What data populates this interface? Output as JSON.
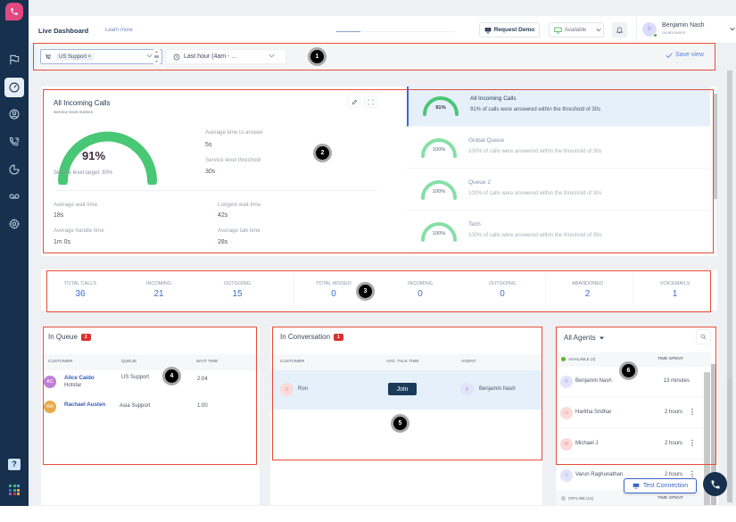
{
  "header": {
    "title": "Live Dashboard",
    "learn_more": "Learn more",
    "request_demo": "Request Demo",
    "status": "Available",
    "user_initial": "B",
    "user_name": "Benjamin Nash",
    "user_sub": "ON BROWSER",
    "loading_progress": 0.2
  },
  "filters": {
    "queue_chip": "US Support ×",
    "time_range": "Last hour (4am - ...",
    "save_view": "Save view"
  },
  "service_level": {
    "title": "All Incoming Calls",
    "subtitle": "Service level metrics",
    "percent": "91%",
    "gauge_value": 0.91,
    "target": "Service level target: 80%",
    "metrics": [
      {
        "label": "Average time to answer",
        "value": "5s"
      },
      {
        "label": "Service level threshold",
        "value": "30s"
      },
      {
        "label": "Average wait time",
        "value": "18s"
      },
      {
        "label": "Longest wait time",
        "value": "42s"
      },
      {
        "label": "Average handle time",
        "value": "1m 0s"
      },
      {
        "label": "Average talk time",
        "value": "28s"
      }
    ],
    "queues": [
      {
        "name": "All Incoming Calls",
        "percent": "91%",
        "value": 0.91,
        "desc": "91% of calls were answered within the threshold of 30s",
        "active": true
      },
      {
        "name": "Global Queue",
        "percent": "100%",
        "value": 1.0,
        "desc": "100% of calls were answered within the threshold of 30s",
        "active": false
      },
      {
        "name": "Queue 2",
        "percent": "100%",
        "value": 1.0,
        "desc": "100% of calls were answered within the threshold of 30s",
        "active": false
      },
      {
        "name": "Tech",
        "percent": "100%",
        "value": 1.0,
        "desc": "100% of calls were answered within the threshold of 30s",
        "active": false
      }
    ]
  },
  "stats": [
    {
      "label": "TOTAL CALLS",
      "value": "36"
    },
    {
      "label": "INCOMING",
      "value": "21"
    },
    {
      "label": "OUTGOING",
      "value": "15"
    },
    {
      "label": "TOTAL MISSED",
      "value": "0"
    },
    {
      "label": "INCOMING",
      "value": "0"
    },
    {
      "label": "OUTGOING",
      "value": "0"
    },
    {
      "label": "ABANDONED",
      "value": "2"
    },
    {
      "label": "VOICEMAILS",
      "value": "1"
    }
  ],
  "in_queue": {
    "title": "In Queue",
    "count": "2",
    "columns": [
      "CUSTOMER",
      "QUEUE",
      "WAIT TIME"
    ],
    "rows": [
      {
        "initials": "AC",
        "name": "Alice Caido",
        "company": "Hotstar",
        "queue": "US Support",
        "wait": "2:04",
        "color": "#c07ed8"
      },
      {
        "initials": "RA",
        "name": "Rachael Austen",
        "company": "",
        "queue": "Asia Support",
        "wait": "1:00",
        "color": "#e8a94a"
      }
    ]
  },
  "in_conversation": {
    "title": "In Conversation",
    "count": "1",
    "columns": [
      "CUSTOMER",
      "AVG. TALK TIME",
      "AGENT"
    ],
    "rows": [
      {
        "customer_initial": "R",
        "customer": "Ron",
        "action": "Join",
        "agent_initial": "B",
        "agent": "Benjamin Nash"
      }
    ]
  },
  "agents": {
    "title": "All Agents",
    "available_label": "AVAILABLE (4)",
    "time_header": "TIME SPENT",
    "offline_label": "OFFLINE (14)",
    "offline_time_header": "TIME SPENT",
    "rows": [
      {
        "initial": "B",
        "name": "Benjamin Nash",
        "time": "13 minutes",
        "more": false,
        "bg": "#e3e3fb",
        "fg": "#a4a4ea"
      },
      {
        "initial": "H",
        "name": "Haritha Sridhar",
        "time": "2 hours",
        "more": true,
        "bg": "#fbdada",
        "fg": "#ef9b9b"
      },
      {
        "initial": "M",
        "name": "Michael J",
        "time": "2 hours",
        "more": true,
        "bg": "#fbdada",
        "fg": "#ef9b9b"
      },
      {
        "initial": "V",
        "name": "Varun Raghunathan",
        "time": "2 hours",
        "more": true,
        "bg": "#e3e3fb",
        "fg": "#a4a4ea"
      }
    ]
  },
  "floating": {
    "test_connection": "Test Connection"
  },
  "annotations": [
    "1",
    "2",
    "3",
    "4",
    "5",
    "6"
  ],
  "colors": {
    "sidebar": "#16304d",
    "gauge_green": "#48c774",
    "gauge_light_green": "#86dfa6",
    "accent_blue": "#3e6fc9",
    "annotation_red": "#e94c37",
    "badge_red": "#d9312f"
  }
}
